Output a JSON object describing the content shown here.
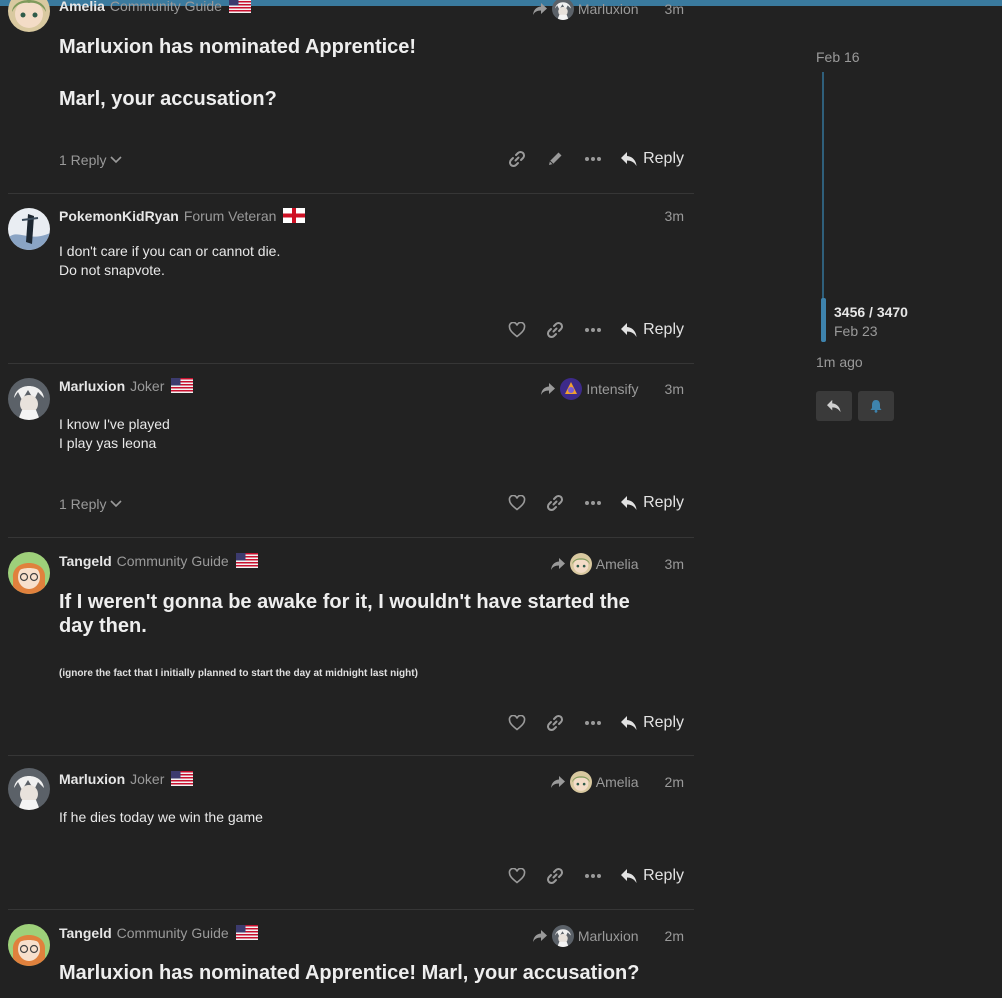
{
  "posts": [
    {
      "user": "Amelia",
      "title": "Community Guide",
      "flag": "US",
      "reply_to": "Marluxion",
      "time": "3m",
      "lines": [
        "Marluxion has nominated Apprentice!",
        "Marl, your accusation?"
      ],
      "replies": "1 Reply",
      "action_icons": [
        "link-icon",
        "pencil-icon",
        "more-icon"
      ],
      "reply_label": "Reply"
    },
    {
      "user": "PokemonKidRyan",
      "title": "Forum Veteran",
      "flag": "England",
      "time": "3m",
      "lines": [
        "I don't care if you can or cannot die.",
        "Do not snapvote."
      ],
      "action_icons": [
        "heart-icon",
        "link-icon",
        "more-icon"
      ],
      "reply_label": "Reply"
    },
    {
      "user": "Marluxion",
      "title": "Joker",
      "flag": "US",
      "reply_to": "Intensify",
      "time": "3m",
      "lines": [
        "I know I've played",
        "I play yas leona"
      ],
      "replies": "1 Reply",
      "action_icons": [
        "heart-icon",
        "link-icon",
        "more-icon"
      ],
      "reply_label": "Reply"
    },
    {
      "user": "Tangeld",
      "title": "Community Guide",
      "flag": "US",
      "reply_to": "Amelia",
      "time": "3m",
      "heading": "If I weren't gonna be awake for it, I wouldn't have started the day then.",
      "small": "(ignore the fact that I initially planned to start the day at midnight last night)",
      "action_icons": [
        "heart-icon",
        "link-icon",
        "more-icon"
      ],
      "reply_label": "Reply"
    },
    {
      "user": "Marluxion",
      "title": "Joker",
      "flag": "US",
      "reply_to": "Amelia",
      "time": "2m",
      "lines": [
        "If he dies today we win the game"
      ],
      "action_icons": [
        "heart-icon",
        "link-icon",
        "more-icon"
      ],
      "reply_label": "Reply"
    },
    {
      "user": "Tangeld",
      "title": "Community Guide",
      "flag": "US",
      "reply_to": "Marluxion",
      "time": "2m",
      "heading": "Marluxion has nominated Apprentice! Marl, your accusation?"
    }
  ],
  "timeline": {
    "start_date": "Feb 16",
    "position": "3456 / 3470",
    "position_date": "Feb 23",
    "last_activity": "1m ago",
    "buttons": [
      "reply-icon",
      "bell-icon"
    ],
    "accent": "#3e83ad"
  }
}
